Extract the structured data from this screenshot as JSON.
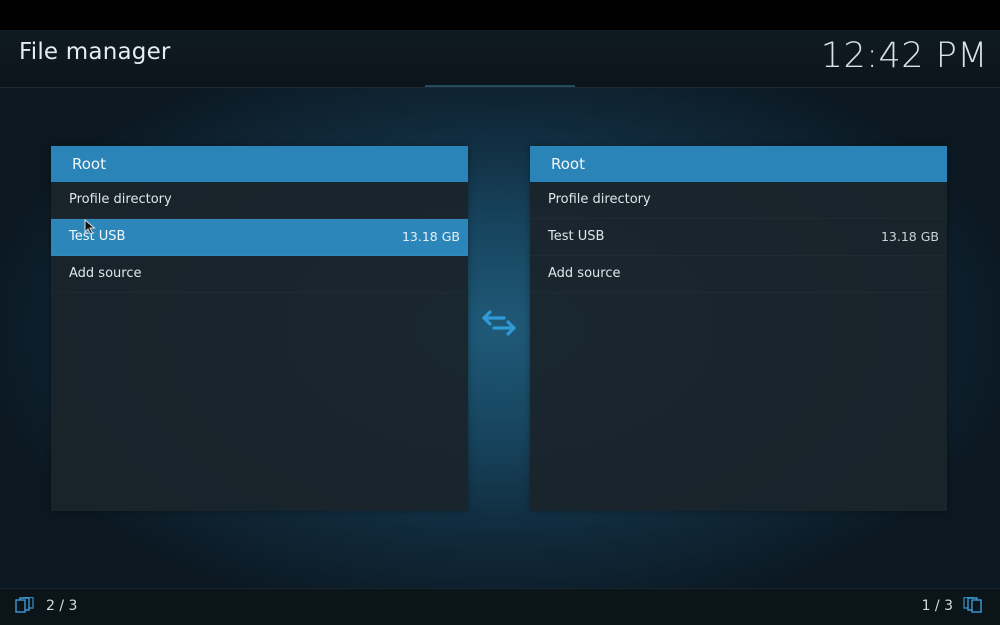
{
  "header": {
    "title": "File manager",
    "clock": "12:42 PM"
  },
  "left_panel": {
    "title": "Root",
    "items": [
      {
        "label": "Profile directory",
        "size": ""
      },
      {
        "label": "Test USB",
        "size": "13.18 GB",
        "selected": true
      },
      {
        "label": "Add source",
        "size": ""
      }
    ]
  },
  "right_panel": {
    "title": "Root",
    "items": [
      {
        "label": "Profile directory",
        "size": ""
      },
      {
        "label": "Test USB",
        "size": "13.18 GB"
      },
      {
        "label": "Add source",
        "size": ""
      }
    ]
  },
  "footer": {
    "left_page": "2 / 3",
    "right_page": "1 / 3"
  },
  "icons": {
    "swap": "swap-arrows-icon",
    "pager": "folder-stack-icon",
    "cursor": "mouse-pointer-icon"
  },
  "colors": {
    "accent": "#2c86ba",
    "header_bar": "#2a84b8",
    "panel_bg": "#1a242b",
    "swap_icon": "#2f9ad6"
  }
}
